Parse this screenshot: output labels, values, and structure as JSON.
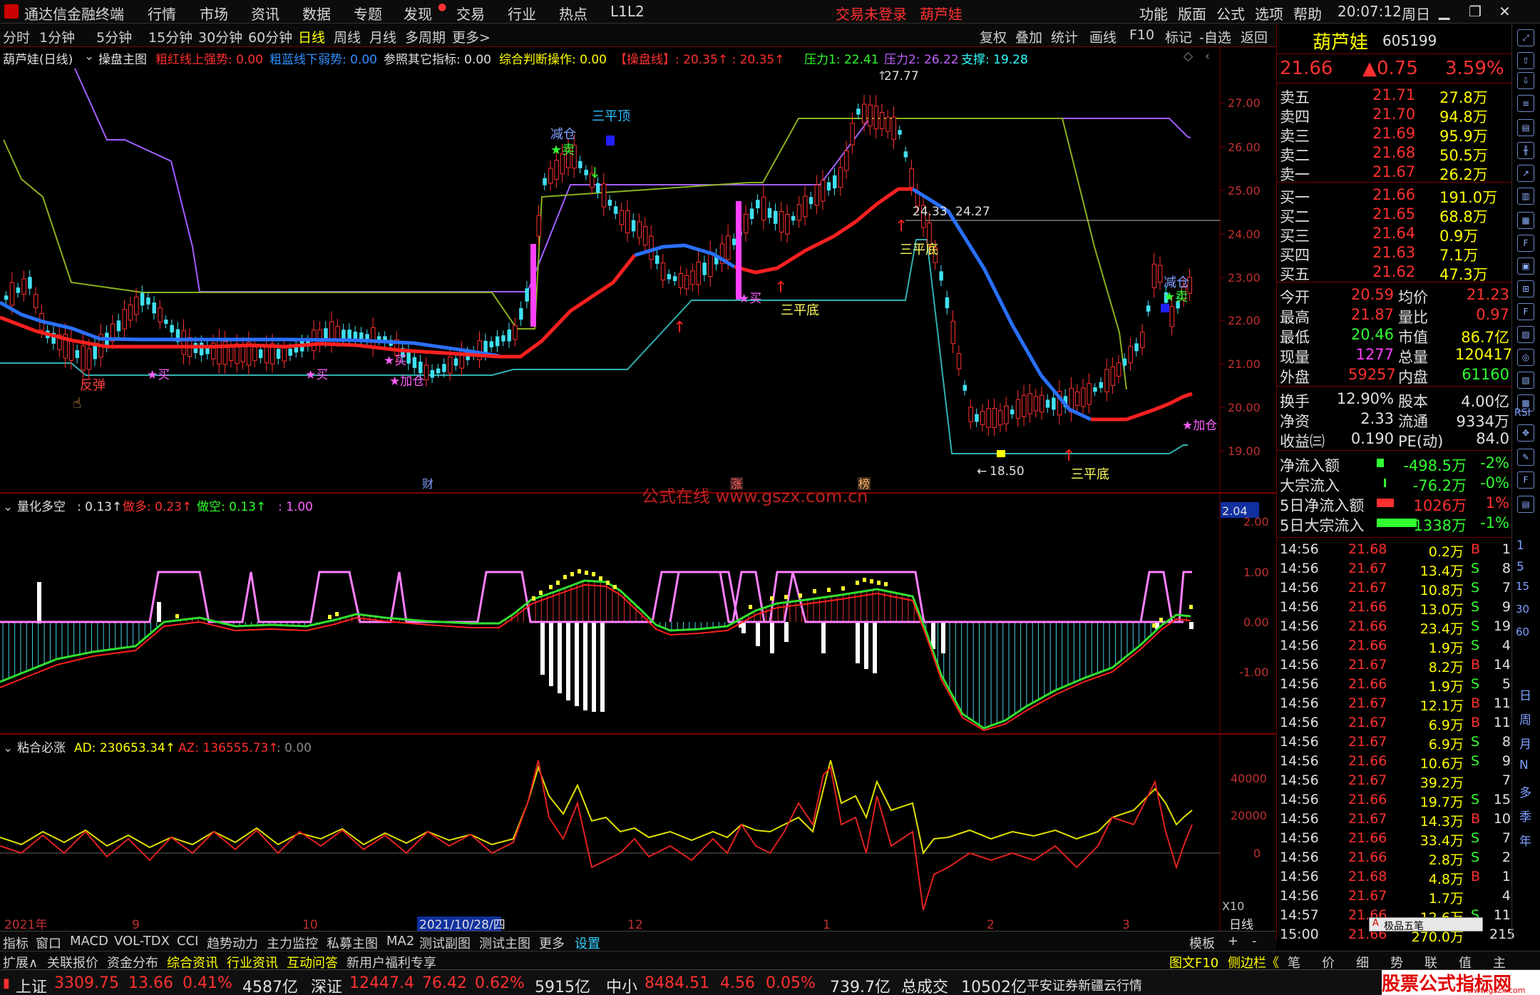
{
  "app": {
    "title": "通达信金融终端",
    "menu": [
      "行情",
      "市场",
      "资讯",
      "数据",
      "专题",
      "发现",
      "交易",
      "行业",
      "热点",
      "L1L2"
    ],
    "trade_status": "交易未登录",
    "stock_name_top": "葫芦娃",
    "right_menu": [
      "功能",
      "版面",
      "公式",
      "选项",
      "帮助"
    ],
    "time": "20:07:12",
    "weekday": "周日"
  },
  "toolbar": {
    "periods": [
      "分时",
      "1分钟",
      "5分钟",
      "15分钟",
      "30分钟",
      "60分钟",
      "日线",
      "周线",
      "月线",
      "多周期",
      "更多>"
    ],
    "right": [
      "复权",
      "叠加",
      "统计",
      "画线",
      "F10",
      "标记",
      "-自选",
      "返回"
    ]
  },
  "main_info": {
    "name": "葫芦娃(日线)",
    "formula": "操盘主图",
    "i1": "粗红线上强势: 0.00",
    "i2": "粗蓝线下弱势: 0.00",
    "i3": "参照其它指标: 0.00",
    "i4": "综合判断操作: 0.00",
    "i5": "【操盘线】: 20.35↑ : 20.35↑",
    "p1": "压力1: 22.41",
    "p2": "压力2: 26.22",
    "p3": "支撑: 19.28"
  },
  "main_axis": [
    "27.00",
    "26.00",
    "25.00",
    "24.00",
    "23.00",
    "22.00",
    "21.00",
    "20.00",
    "19.00"
  ],
  "main_labels": {
    "high": "27.77",
    "low": "18.50",
    "l1": "24.33",
    "l2": "24.27",
    "sanpingding": "三平顶",
    "sandi1": "三平底",
    "sandi2": "三平底",
    "sandi3": "三平底",
    "jiancang1": "减仓",
    "jiancang2": "减仓",
    "mai1": "★卖",
    "mai2": "★卖",
    "fantan": "反弹",
    "buy1": "★买",
    "buy2": "★买",
    "buy3": "★买",
    "buy4": "★买",
    "jiacang1": "★加仓",
    "jiacang2": "★加仓",
    "cai": "财",
    "zhang": "涨",
    "bang": "榜",
    "watermark": "公式在线 www.gszx.com.cn"
  },
  "sub1": {
    "name": "量化多空",
    "v1": ": 0.13↑",
    "v2": "做多: 0.23↑",
    "v3": "做空: 0.13↑",
    "v4": ": 1.00",
    "axis": [
      "2.00",
      "1.00",
      "0.00",
      "-1.00"
    ],
    "flag": "2.04"
  },
  "sub2": {
    "name": "粘合必涨",
    "v1": "AD: 230653.34↑",
    "v2": "AZ: 136555.73↑",
    "v3": ": 0.00",
    "axis": [
      "40000",
      "20000",
      "0"
    ],
    "x10": "X10"
  },
  "xaxis": [
    "2021年",
    "9",
    "10",
    "2021/10/28/四",
    "12",
    "1",
    "2",
    "3",
    "日线"
  ],
  "quote": {
    "name": "葫芦娃",
    "code": "605199",
    "price": "21.66",
    "change": "▲0.75",
    "pct": "3.59%"
  },
  "asks": [
    [
      "卖五",
      "21.71",
      "27.8万"
    ],
    [
      "卖四",
      "21.70",
      "94.8万"
    ],
    [
      "卖三",
      "21.69",
      "95.9万"
    ],
    [
      "卖二",
      "21.68",
      "50.5万"
    ],
    [
      "卖一",
      "21.67",
      "26.2万"
    ]
  ],
  "bids": [
    [
      "买一",
      "21.66",
      "191.0万"
    ],
    [
      "买二",
      "21.65",
      "68.8万"
    ],
    [
      "买三",
      "21.64",
      "0.9万"
    ],
    [
      "买四",
      "21.63",
      "7.1万"
    ],
    [
      "买五",
      "21.62",
      "47.3万"
    ]
  ],
  "stats": [
    [
      "今开",
      "20.59",
      "均价",
      "21.23"
    ],
    [
      "最高",
      "21.87",
      "量比",
      "0.97"
    ],
    [
      "最低",
      "20.46",
      "市值",
      "86.7亿"
    ],
    [
      "现量",
      "1277",
      "总量",
      "120417"
    ],
    [
      "外盘",
      "59257",
      "内盘",
      "61160"
    ]
  ],
  "stats2": [
    [
      "换手",
      "12.90%",
      "股本",
      "4.00亿"
    ],
    [
      "净资",
      "2.33",
      "流通",
      "9334万"
    ],
    [
      "收益㈢",
      "0.190",
      "PE(动)",
      "84.0"
    ]
  ],
  "flows": [
    [
      "净流入额",
      "-498.5万",
      "-2%"
    ],
    [
      "大宗流入",
      "-76.2万",
      "-0%"
    ],
    [
      "5日净流入额",
      "1026万",
      "1%"
    ],
    [
      "5日大宗流入",
      "-1338万",
      "-1%"
    ]
  ],
  "ticks": [
    [
      "14:56",
      "21.68",
      "0.2万",
      "B",
      "1"
    ],
    [
      "14:56",
      "21.67",
      "13.4万",
      "S",
      "8"
    ],
    [
      "14:56",
      "21.67",
      "10.8万",
      "S",
      "7"
    ],
    [
      "14:56",
      "21.66",
      "13.0万",
      "S",
      "9"
    ],
    [
      "14:56",
      "21.66",
      "23.4万",
      "S",
      "19"
    ],
    [
      "14:56",
      "21.66",
      "1.9万",
      "S",
      "4"
    ],
    [
      "14:56",
      "21.67",
      "8.2万",
      "B",
      "14"
    ],
    [
      "14:56",
      "21.66",
      "1.9万",
      "S",
      "5"
    ],
    [
      "14:56",
      "21.67",
      "12.1万",
      "B",
      "11"
    ],
    [
      "14:56",
      "21.67",
      "6.9万",
      "B",
      "11"
    ],
    [
      "14:56",
      "21.67",
      "6.9万",
      "S",
      "8"
    ],
    [
      "14:56",
      "21.66",
      "10.6万",
      "S",
      "9"
    ],
    [
      "14:56",
      "21.67",
      "39.2万",
      "",
      "7"
    ],
    [
      "14:56",
      "21.66",
      "19.7万",
      "S",
      "15"
    ],
    [
      "14:56",
      "21.67",
      "14.3万",
      "B",
      "10"
    ],
    [
      "14:56",
      "21.66",
      "33.4万",
      "S",
      "7"
    ],
    [
      "14:56",
      "21.66",
      "2.8万",
      "S",
      "2"
    ],
    [
      "14:56",
      "21.68",
      "4.8万",
      "B",
      "1"
    ],
    [
      "14:56",
      "21.67",
      "1.7万",
      "",
      "4"
    ],
    [
      "14:57",
      "21.66",
      "12.6万",
      "S",
      "11"
    ],
    [
      "15:00",
      "21.66",
      "270.0万",
      "",
      "215"
    ]
  ],
  "side_tabs": [
    "日",
    "周",
    "月",
    "N",
    "多",
    "季",
    "年"
  ],
  "side_labels": [
    "RSI",
    "15",
    "30",
    "60"
  ],
  "bottom_tabs": [
    "指标",
    "窗口",
    "MACD",
    "VOL-TDX",
    "CCI",
    "趋势动力",
    "主力监控",
    "私募主图",
    "MA2",
    "测试副图",
    "测试主图",
    "更多",
    "设置"
  ],
  "bottom_right": [
    "模板",
    "+",
    "-"
  ],
  "links": [
    "扩展∧",
    "关联报价",
    "资金分布",
    "综合资讯",
    "行业资讯",
    "互动问答",
    "新用户福利专享"
  ],
  "links_right": [
    "图文F10",
    "侧边栏《",
    "笔",
    "价",
    "细",
    "势",
    "联",
    "值",
    "主"
  ],
  "ime": "极品五笔",
  "status": {
    "sh": "上证",
    "sh_v": "3309.75",
    "sh_c": "13.66",
    "sh_p": "0.41%",
    "sh_a": "4587亿",
    "sz": "深证",
    "sz_v": "12447.4",
    "sz_c": "76.42",
    "sz_p": "0.62%",
    "sz_a": "5915亿",
    "zx": "中小",
    "zx_v": "8484.51",
    "zx_c": "4.56",
    "zx_p": "0.05%",
    "zx_a": "739.7亿",
    "total": "总成交",
    "total_v": "10502亿",
    "broker": "平安证券新疆云行情",
    "brand": "股票公式指标网",
    "brand_url": "www.gszx.com"
  }
}
